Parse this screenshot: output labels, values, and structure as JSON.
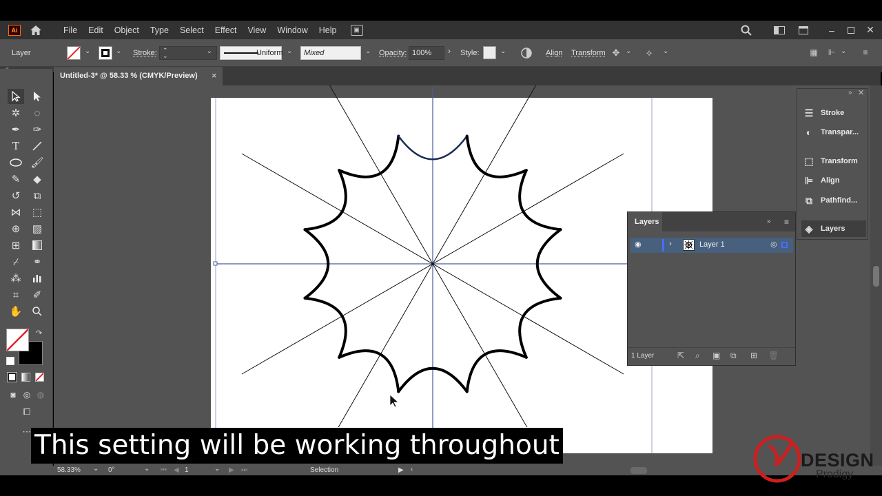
{
  "app": {
    "logo": "Ai",
    "brand_color": "#ff6a00"
  },
  "menu": [
    "File",
    "Edit",
    "Object",
    "Type",
    "Select",
    "Effect",
    "View",
    "Window",
    "Help"
  ],
  "control": {
    "selection_label": "Layer",
    "stroke_label": "Stroke:",
    "profile_label": "Uniform",
    "brush_value": "Mixed",
    "opacity_label": "Opacity:",
    "opacity_value": "100%",
    "style_label": "Style:",
    "align_label": "Align",
    "transform_label": "Transform"
  },
  "document": {
    "tab_title": "Untitled-3* @ 58.33 % (CMYK/Preview)",
    "close_glyph": "×"
  },
  "dock": {
    "items": [
      {
        "label": "Stroke",
        "icon": "stroke-icon"
      },
      {
        "label": "Transpar...",
        "icon": "transparency-icon"
      },
      {
        "label": "Transform",
        "icon": "transform-icon"
      },
      {
        "label": "Align",
        "icon": "align-icon"
      },
      {
        "label": "Pathfind...",
        "icon": "pathfinder-icon"
      },
      {
        "label": "Layers",
        "icon": "layers-icon"
      }
    ]
  },
  "layers": {
    "title": "Layers",
    "rows": [
      {
        "name": "Layer 1",
        "visible": true,
        "color": "#4a6cff"
      }
    ],
    "footer_count": "1 Layer"
  },
  "status": {
    "zoom": "58.33%",
    "rotation": "0°",
    "artboard": "1",
    "tool": "Selection"
  },
  "subtitle": "This setting will be working throughout",
  "watermark": {
    "brand": "DESIGN",
    "sub": "Prodigy",
    "color": "#cc1f1f"
  }
}
